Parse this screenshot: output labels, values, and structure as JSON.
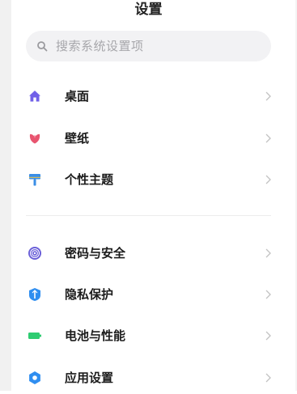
{
  "header": {
    "title": "设置"
  },
  "search": {
    "placeholder": "搜索系统设置项"
  },
  "groups": [
    {
      "items": [
        {
          "label": "桌面",
          "icon": "home-icon",
          "color": "#7160e8"
        },
        {
          "label": "壁纸",
          "icon": "tulip-icon",
          "color": "#e8546f"
        },
        {
          "label": "个性主题",
          "icon": "paint-roller-icon",
          "color": "#3a8ee6"
        }
      ]
    },
    {
      "items": [
        {
          "label": "密码与安全",
          "icon": "fingerprint-icon",
          "color": "#6a5fd8"
        },
        {
          "label": "隐私保护",
          "icon": "shield-icon",
          "color": "#2f8ef0"
        },
        {
          "label": "电池与性能",
          "icon": "battery-icon",
          "color": "#2ecc71"
        },
        {
          "label": "应用设置",
          "icon": "gear-icon",
          "color": "#2f8ef0"
        }
      ]
    }
  ],
  "colors": {
    "background": "#ffffff",
    "search_bg": "#f2f2f4",
    "chevron": "#c2c2c2",
    "divider": "#ececec"
  }
}
